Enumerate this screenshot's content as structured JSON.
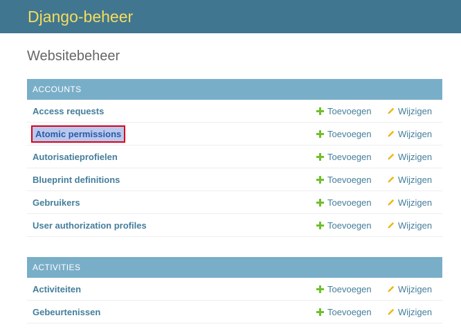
{
  "header": {
    "brand": "Django-beheer"
  },
  "page_title": "Websitebeheer",
  "colors": {
    "header_bg": "#417690",
    "brand": "#f5dd5d",
    "module_bg": "#79aec8",
    "add_icon": "#70bf2b",
    "change_icon": "#efb80b",
    "link": "#447e9b"
  },
  "modules": [
    {
      "caption": "ACCOUNTS",
      "rows": [
        {
          "name": "Access requests",
          "add": "Toevoegen",
          "change": "Wijzigen"
        },
        {
          "name": "Atomic permissions",
          "add": "Toevoegen",
          "change": "Wijzigen"
        },
        {
          "name": "Autorisatieprofielen",
          "add": "Toevoegen",
          "change": "Wijzigen"
        },
        {
          "name": "Blueprint definitions",
          "add": "Toevoegen",
          "change": "Wijzigen"
        },
        {
          "name": "Gebruikers",
          "add": "Toevoegen",
          "change": "Wijzigen"
        },
        {
          "name": "User authorization profiles",
          "add": "Toevoegen",
          "change": "Wijzigen"
        }
      ]
    },
    {
      "caption": "ACTIVITIES",
      "rows": [
        {
          "name": "Activiteiten",
          "add": "Toevoegen",
          "change": "Wijzigen"
        },
        {
          "name": "Gebeurtenissen",
          "add": "Toevoegen",
          "change": "Wijzigen"
        }
      ]
    }
  ]
}
